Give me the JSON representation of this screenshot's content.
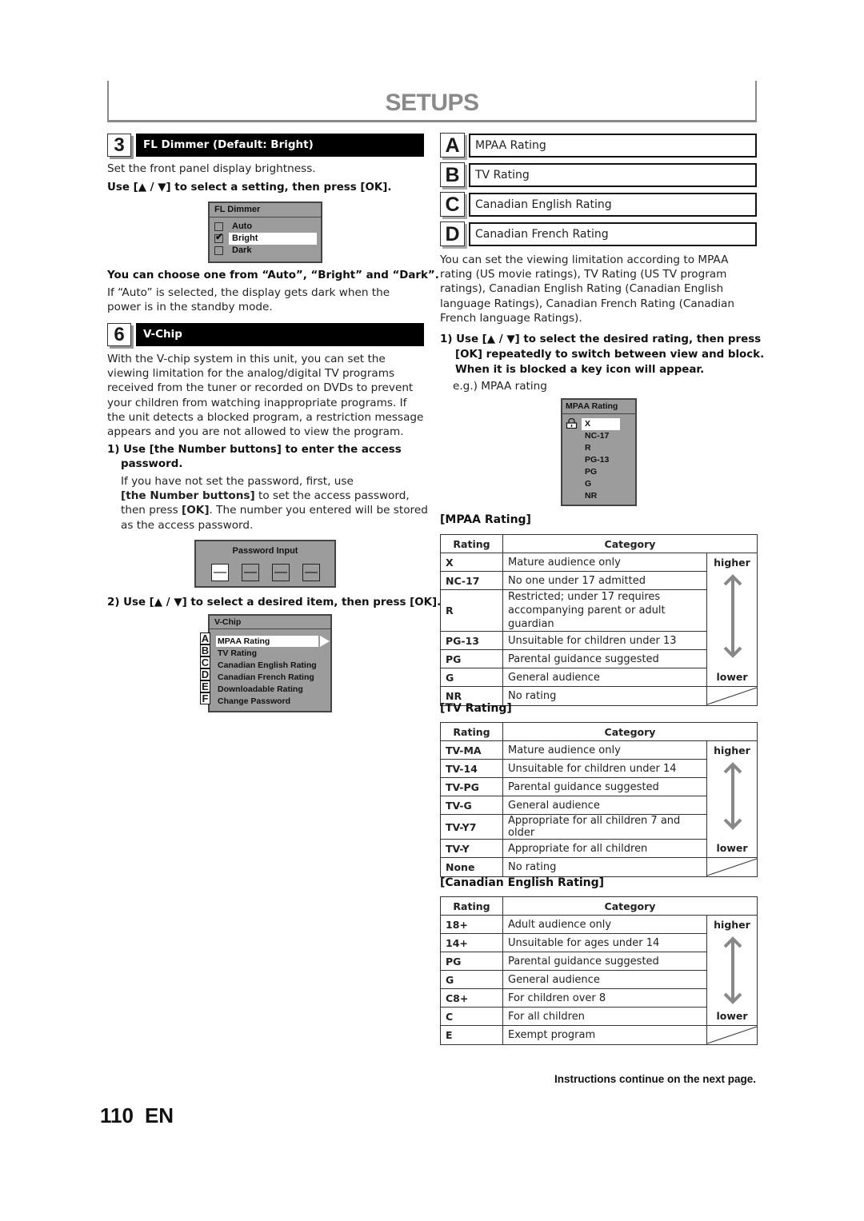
{
  "header": {
    "title": "SETUPS"
  },
  "fl_dimmer": {
    "number": "3",
    "title": "FL Dimmer (Default: Bright)",
    "intro": "Set the front panel display brightness.",
    "instruction": "Use [▲ / ▼] to select a setting, then press [OK].",
    "osd": {
      "title": "FL Dimmer",
      "options": [
        {
          "label": "Auto",
          "checked": false,
          "selected": false
        },
        {
          "label": "Bright",
          "checked": true,
          "selected": true
        },
        {
          "label": "Dark",
          "checked": false,
          "selected": false
        }
      ]
    },
    "choose_text": "You can choose one from “Auto”, “Bright” and “Dark”.",
    "note_line1": "If “Auto” is selected, the display gets dark when the",
    "note_line2": "power is in the standby mode."
  },
  "vchip": {
    "number": "6",
    "title": "V-Chip",
    "desc_lines": [
      "With the V-chip system in this unit, you can set the",
      "viewing limitation for the analog/digital TV programs",
      "received from the tuner or recorded on DVDs to prevent",
      "your children from watching inappropriate programs. If",
      "the unit detects a blocked program, a restriction message",
      "appears and you are not allowed to view the program."
    ],
    "step1": {
      "line1": "1) Use [the Number buttons] to enter the access",
      "line2": "password.",
      "body_line1": "If you have not set the password, first, use",
      "body_bold1": "[the Number buttons]",
      "body_line2_rest": " to set the access password,",
      "body_line3_pre": "then press ",
      "body_bold2": "[OK]",
      "body_line3_rest": ". The number you entered will be stored",
      "body_line4": "as the access password."
    },
    "password_osd": {
      "title": "Password Input",
      "slots": [
        "—",
        "—",
        "—",
        "—"
      ]
    },
    "step2": "2) Use [▲ / ▼] to select a desired item, then press [OK].",
    "menu_osd": {
      "title": "V-Chip",
      "items": [
        {
          "letter": "A",
          "label": "MPAA Rating",
          "selected": true
        },
        {
          "letter": "B",
          "label": "TV Rating",
          "selected": false
        },
        {
          "letter": "C",
          "label": "Canadian English Rating",
          "selected": false
        },
        {
          "letter": "D",
          "label": "Canadian French Rating",
          "selected": false
        },
        {
          "letter": "E",
          "label": "Downloadable Rating",
          "selected": false
        },
        {
          "letter": "F",
          "label": "Change Password",
          "selected": false
        }
      ]
    }
  },
  "right": {
    "letters": [
      {
        "letter": "A",
        "label": "MPAA Rating"
      },
      {
        "letter": "B",
        "label": "TV Rating"
      },
      {
        "letter": "C",
        "label": "Canadian English Rating"
      },
      {
        "letter": "D",
        "label": "Canadian French Rating"
      }
    ],
    "desc_lines": [
      "You can set the viewing limitation according to MPAA",
      "rating (US movie ratings), TV Rating (US TV program",
      "ratings), Canadian English Rating (Canadian English",
      "language Ratings), Canadian French Rating (Canadian",
      "French language Ratings)."
    ],
    "step1_lines": [
      "1) Use [▲ / ▼] to select the desired rating, then press",
      "[OK] repeatedly to switch between view and block.",
      "When it is blocked a key icon will appear."
    ],
    "example": "e.g.) MPAA rating",
    "mpaa_osd": {
      "title": "MPAA Rating",
      "items": [
        {
          "label": "X",
          "locked": true,
          "selected": true
        },
        {
          "label": "NC-17",
          "locked": false,
          "selected": false
        },
        {
          "label": "R",
          "locked": false,
          "selected": false
        },
        {
          "label": "PG-13",
          "locked": false,
          "selected": false
        },
        {
          "label": "PG",
          "locked": false,
          "selected": false
        },
        {
          "label": "G",
          "locked": false,
          "selected": false
        },
        {
          "label": "NR",
          "locked": false,
          "selected": false
        }
      ]
    }
  },
  "tables": {
    "col_rating": "Rating",
    "col_category": "Category",
    "higher": "higher",
    "lower": "lower",
    "mpaa": {
      "title": "[MPAA Rating]",
      "rows": [
        {
          "rating": "X",
          "category": "Mature audience only"
        },
        {
          "rating": "NC-17",
          "category": "No one under 17 admitted"
        },
        {
          "rating": "R",
          "category": "Restricted; under 17 requires",
          "category2": "accompanying parent or adult guardian"
        },
        {
          "rating": "PG-13",
          "category": "Unsuitable for children under 13"
        },
        {
          "rating": "PG",
          "category": "Parental guidance suggested"
        },
        {
          "rating": "G",
          "category": "General audience"
        },
        {
          "rating": "NR",
          "category": "No rating"
        }
      ]
    },
    "tv": {
      "title": "[TV Rating]",
      "rows": [
        {
          "rating": "TV-MA",
          "category": "Mature audience only"
        },
        {
          "rating": "TV-14",
          "category": "Unsuitable for children under 14"
        },
        {
          "rating": "TV-PG",
          "category": "Parental guidance suggested"
        },
        {
          "rating": "TV-G",
          "category": "General audience"
        },
        {
          "rating": "TV-Y7",
          "category": "Appropriate for all children 7 and older"
        },
        {
          "rating": "TV-Y",
          "category": "Appropriate for all children"
        },
        {
          "rating": "None",
          "category": "No rating"
        }
      ]
    },
    "can_en": {
      "title": "[Canadian English Rating]",
      "rows": [
        {
          "rating": "18+",
          "category": "Adult audience only"
        },
        {
          "rating": "14+",
          "category": "Unsuitable for ages under 14"
        },
        {
          "rating": "PG",
          "category": "Parental guidance suggested"
        },
        {
          "rating": "G",
          "category": "General audience"
        },
        {
          "rating": "C8+",
          "category": "For children over 8"
        },
        {
          "rating": "C",
          "category": "For all children"
        },
        {
          "rating": "E",
          "category": "Exempt program"
        }
      ]
    }
  },
  "footer": {
    "continue": "Instructions continue on the next page.",
    "page_number": "110",
    "lang": "EN"
  }
}
